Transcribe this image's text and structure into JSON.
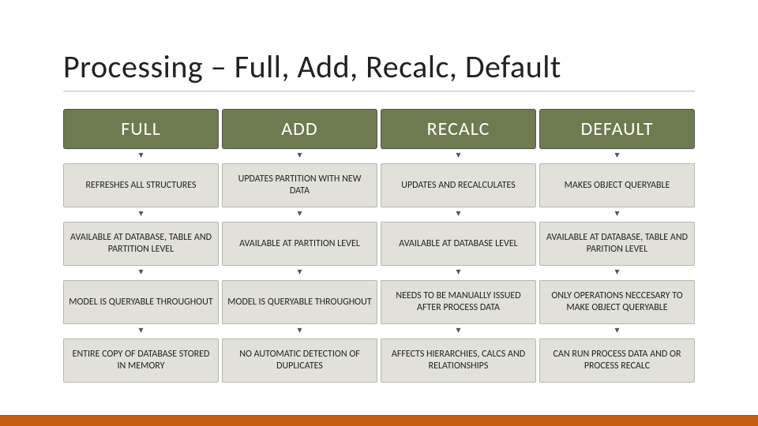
{
  "title": "Processing – Full, Add, Recalc, Default",
  "columns": [
    {
      "head": "FULL",
      "rows": [
        "REFRESHES ALL STRUCTURES",
        "AVAILABLE AT DATABASE, TABLE AND PARTITION LEVEL",
        "MODEL IS QUERYABLE THROUGHOUT",
        "ENTIRE COPY OF DATABASE STORED IN MEMORY"
      ]
    },
    {
      "head": "ADD",
      "rows": [
        "UPDATES PARTITION WITH NEW DATA",
        "AVAILABLE AT PARTITION LEVEL",
        "MODEL IS QUERYABLE THROUGHOUT",
        "NO AUTOMATIC DETECTION OF DUPLICATES"
      ]
    },
    {
      "head": "RECALC",
      "rows": [
        "UPDATES AND RECALCULATES",
        "AVAILABLE AT DATABASE LEVEL",
        "NEEDS TO BE MANUALLY ISSUED AFTER PROCESS DATA",
        "AFFECTS HIERARCHIES, CALCS AND RELATIONSHIPS"
      ]
    },
    {
      "head": "DEFAULT",
      "rows": [
        "MAKES OBJECT QUERYABLE",
        "AVAILABLE AT DATABASE, TABLE AND PARITION LEVEL",
        "ONLY OPERATIONS NECCESARY TO MAKE OBJECT QUERYABLE",
        "CAN RUN PROCESS DATA AND OR PROCESS RECALC"
      ]
    }
  ],
  "arrow_glyph": "▾"
}
